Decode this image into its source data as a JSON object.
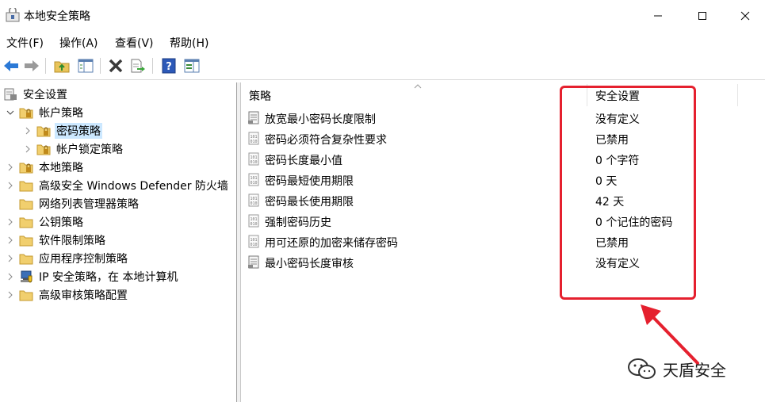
{
  "window": {
    "title": "本地安全策略"
  },
  "menu": [
    "文件(F)",
    "操作(A)",
    "查看(V)",
    "帮助(H)"
  ],
  "toolbar": [
    "back-icon",
    "forward-icon",
    "up-folder-icon",
    "show-hide-tree-icon",
    "delete-icon",
    "export-list-icon",
    "help-icon",
    "properties-icon"
  ],
  "tree": [
    {
      "label": "安全设置",
      "level": 0,
      "icon": "security-settings-icon",
      "expanded": true
    },
    {
      "label": "帐户策略",
      "level": 1,
      "icon": "folder-lock-icon",
      "expanded": true
    },
    {
      "label": "密码策略",
      "level": 2,
      "icon": "folder-lock-icon",
      "selected": true
    },
    {
      "label": "帐户锁定策略",
      "level": 2,
      "icon": "folder-lock-icon"
    },
    {
      "label": "本地策略",
      "level": 1,
      "icon": "folder-lock-icon"
    },
    {
      "label": "高级安全 Windows Defender 防火墙",
      "level": 1,
      "icon": "folder-icon"
    },
    {
      "label": "网络列表管理器策略",
      "level": 1,
      "icon": "folder-icon",
      "no_expander": true
    },
    {
      "label": "公钥策略",
      "level": 1,
      "icon": "folder-icon"
    },
    {
      "label": "软件限制策略",
      "level": 1,
      "icon": "folder-icon"
    },
    {
      "label": "应用程序控制策略",
      "level": 1,
      "icon": "folder-icon"
    },
    {
      "label": "IP 安全策略，在 本地计算机",
      "level": 1,
      "icon": "ip-security-icon"
    },
    {
      "label": "高级审核策略配置",
      "level": 1,
      "icon": "folder-icon"
    }
  ],
  "list": {
    "columns": [
      "策略",
      "安全设置"
    ],
    "rows": [
      {
        "name": "放宽最小密码长度限制",
        "value": "没有定义",
        "icon": "policy-setting-icon"
      },
      {
        "name": "密码必须符合复杂性要求",
        "value": "已禁用",
        "icon": "policy-binary-icon"
      },
      {
        "name": "密码长度最小值",
        "value": "0 个字符",
        "icon": "policy-binary-icon"
      },
      {
        "name": "密码最短使用期限",
        "value": "0 天",
        "icon": "policy-binary-icon"
      },
      {
        "name": "密码最长使用期限",
        "value": "42 天",
        "icon": "policy-binary-icon"
      },
      {
        "name": "强制密码历史",
        "value": "0 个记住的密码",
        "icon": "policy-binary-icon"
      },
      {
        "name": "用可还原的加密来储存密码",
        "value": "已禁用",
        "icon": "policy-binary-icon"
      },
      {
        "name": "最小密码长度审核",
        "value": "没有定义",
        "icon": "policy-setting-icon"
      }
    ]
  },
  "annotation": {
    "color": "#e5202e"
  },
  "watermark": {
    "text": "天盾安全"
  }
}
